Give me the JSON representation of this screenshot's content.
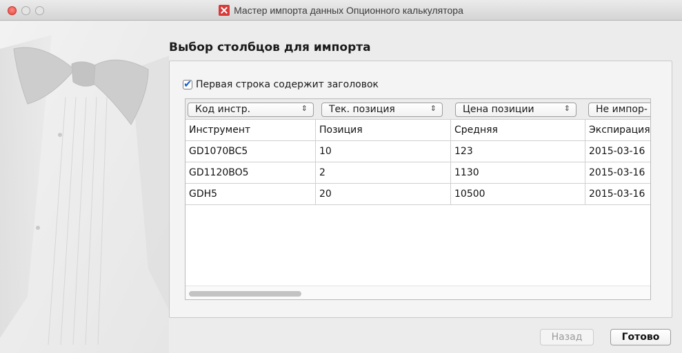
{
  "window": {
    "title": "Мастер импорта данных Опционного калькулятора",
    "app_icon": "app-logo-icon"
  },
  "page": {
    "heading": "Выбор столбцов для импорта",
    "first_row_header_label": "Первая строка содержит заголовок",
    "first_row_header_checked": true
  },
  "columns": [
    {
      "mapping": "Код инстр.",
      "header": "Инструмент"
    },
    {
      "mapping": "Тек. позиция",
      "header": "Позиция"
    },
    {
      "mapping": "Цена позиции",
      "header": "Средняя"
    },
    {
      "mapping": "Не импор-",
      "header": "Экспирация"
    }
  ],
  "rows": [
    [
      "GD1070BC5",
      "10",
      "123",
      "2015-03-16"
    ],
    [
      "GD1120BO5",
      "2",
      "1130",
      "2015-03-16"
    ],
    [
      "GDH5",
      "20",
      "10500",
      "2015-03-16"
    ]
  ],
  "buttons": {
    "back": "Назад",
    "done": "Готово"
  },
  "colors": {
    "close_button": "#e0443e",
    "checkbox_check": "#1a5fd4",
    "app_icon": "#d93a3a"
  }
}
